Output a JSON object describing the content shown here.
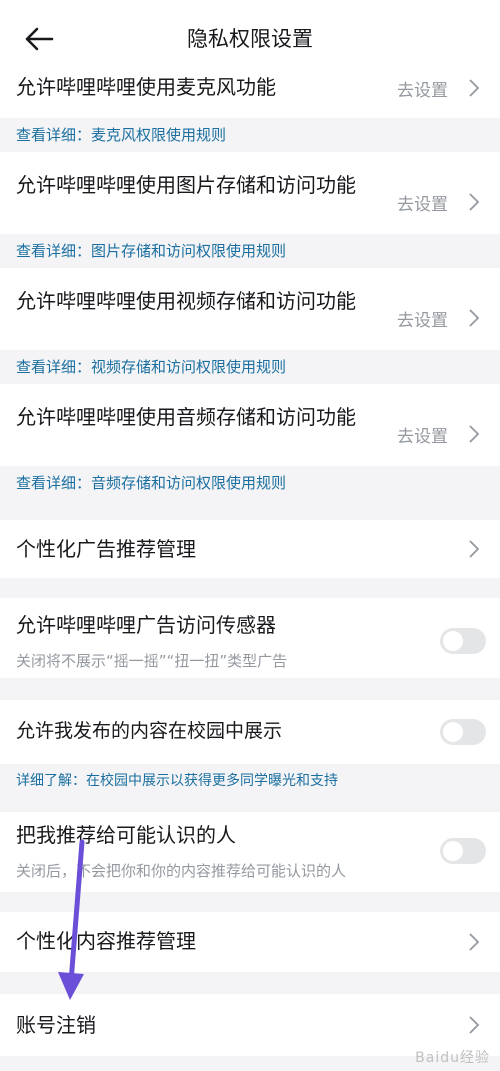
{
  "header": {
    "title": "隐私权限设置"
  },
  "rows": {
    "mic": {
      "label": "允许哔哩哔哩使用麦克风功能",
      "action": "去设置",
      "detail": "查看详细：麦克风权限使用规则"
    },
    "image": {
      "label": "允许哔哩哔哩使用图片存储和访问功能",
      "action": "去设置",
      "detail": "查看详细：图片存储和访问权限使用规则"
    },
    "video": {
      "label": "允许哔哩哔哩使用视频存储和访问功能",
      "action": "去设置",
      "detail": "查看详细：视频存储和访问权限使用规则"
    },
    "audio": {
      "label": "允许哔哩哔哩使用音频存储和访问功能",
      "action": "去设置",
      "detail": "查看详细：音频存储和访问权限使用规则"
    },
    "ad_manage": {
      "label": "个性化广告推荐管理"
    },
    "ad_sensor": {
      "label": "允许哔哩哔哩广告访问传感器",
      "sub": "关闭将不展示“摇一摇”“扭一扭”类型广告",
      "enabled": false
    },
    "campus": {
      "label": "允许我发布的内容在校园中展示",
      "detail": "详细了解：在校园中展示以获得更多同学曝光和支持",
      "enabled": false
    },
    "recommend_people": {
      "label": "把我推荐给可能认识的人",
      "sub": "关闭后，不会把你和你的内容推荐给可能认识的人",
      "enabled": false
    },
    "content_manage": {
      "label": "个性化内容推荐管理"
    },
    "cancel_account": {
      "label": "账号注销"
    }
  },
  "watermark": "Baidu经验",
  "colors": {
    "detail_link": "#1a6fa0",
    "arrow": "#6b4fd8",
    "toggle_off": "#e3e5e7"
  }
}
